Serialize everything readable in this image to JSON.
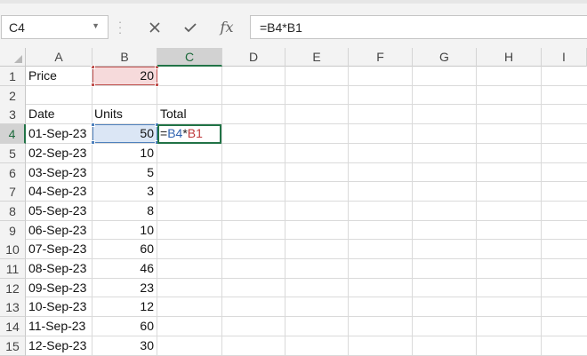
{
  "name_box": {
    "value": "C4"
  },
  "formula_bar": {
    "cancel_icon": "x-icon",
    "enter_icon": "checkmark-icon",
    "fx_label": "fx",
    "formula": "=B4*B1"
  },
  "columns": [
    "A",
    "B",
    "C",
    "D",
    "E",
    "F",
    "G",
    "H",
    "I"
  ],
  "active_column": "C",
  "rows": [
    "1",
    "2",
    "3",
    "4",
    "5",
    "6",
    "7",
    "8",
    "9",
    "10",
    "11",
    "12",
    "13",
    "14",
    "15"
  ],
  "active_row": "4",
  "cells": {
    "A1": "Price",
    "B1": "20",
    "A3": "Date",
    "B3": "Units",
    "C3": "Total"
  },
  "data_rows": [
    {
      "date": "01-Sep-23",
      "units": "50"
    },
    {
      "date": "02-Sep-23",
      "units": "10"
    },
    {
      "date": "03-Sep-23",
      "units": "5"
    },
    {
      "date": "04-Sep-23",
      "units": "3"
    },
    {
      "date": "05-Sep-23",
      "units": "8"
    },
    {
      "date": "06-Sep-23",
      "units": "10"
    },
    {
      "date": "07-Sep-23",
      "units": "60"
    },
    {
      "date": "08-Sep-23",
      "units": "46"
    },
    {
      "date": "09-Sep-23",
      "units": "23"
    },
    {
      "date": "10-Sep-23",
      "units": "12"
    },
    {
      "date": "11-Sep-23",
      "units": "60"
    },
    {
      "date": "12-Sep-23",
      "units": "30"
    }
  ],
  "editing": {
    "cell": "C4",
    "eq": "=",
    "ref1": "B4",
    "op": "*",
    "ref2": "B1"
  },
  "colors": {
    "accent_green": "#217346",
    "ref_red": "#c0504d",
    "ref_blue": "#4f81bd"
  }
}
